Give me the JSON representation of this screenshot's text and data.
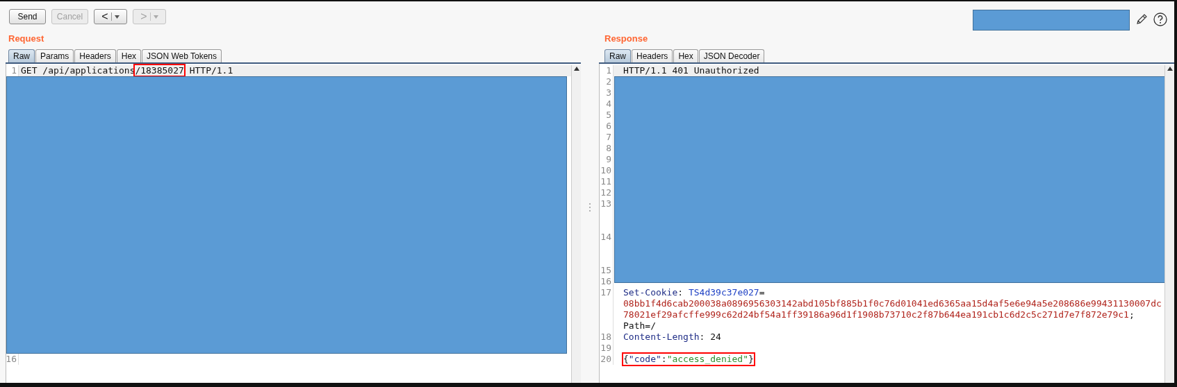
{
  "toolbar": {
    "buttons": [
      {
        "label": "Send",
        "kind": "text",
        "disabled": false
      },
      {
        "label": "Cancel",
        "kind": "text",
        "disabled": true
      },
      {
        "label": "<",
        "kind": "nav",
        "disabled": false
      },
      {
        "label": ">",
        "kind": "nav",
        "disabled": true
      }
    ]
  },
  "request": {
    "title": "Request",
    "tabs": [
      {
        "label": "Raw",
        "selected": true
      },
      {
        "label": "Params",
        "selected": false
      },
      {
        "label": "Headers",
        "selected": false
      },
      {
        "label": "Hex",
        "selected": false
      },
      {
        "label": "JSON Web Tokens",
        "selected": false
      }
    ],
    "lines": [
      {
        "kind": "line",
        "number": "1",
        "current": true,
        "parts": [
          {
            "text": "GET /api/applications",
            "kind": "plain"
          },
          {
            "text": "/18385027",
            "kind": "plain",
            "boxed": true
          },
          {
            "text": " HTTP/1.1",
            "kind": "plain"
          }
        ]
      },
      {
        "kind": "hidden"
      },
      {
        "kind": "line",
        "number": "16"
      }
    ]
  },
  "response": {
    "title": "Response",
    "tabs": [
      {
        "label": "Raw",
        "selected": true
      },
      {
        "label": "Headers",
        "selected": false
      },
      {
        "label": "Hex",
        "selected": false
      },
      {
        "label": "JSON Decoder",
        "selected": false
      }
    ],
    "lines": [
      {
        "kind": "line",
        "number": "1",
        "current": true,
        "parts": [
          {
            "text": "HTTP/1.1 401 Unauthorized",
            "kind": "plain"
          }
        ]
      },
      {
        "kind": "redacted",
        "number": "2"
      },
      {
        "kind": "redacted",
        "number": "3"
      },
      {
        "kind": "redacted",
        "number": "4"
      },
      {
        "kind": "redacted",
        "number": "5"
      },
      {
        "kind": "redacted",
        "number": "6"
      },
      {
        "kind": "redacted",
        "number": "7"
      },
      {
        "kind": "redacted",
        "number": "8"
      },
      {
        "kind": "redacted",
        "number": "9"
      },
      {
        "kind": "redacted",
        "number": "10"
      },
      {
        "kind": "redacted",
        "number": "11"
      },
      {
        "kind": "redacted",
        "number": "12"
      },
      {
        "kind": "redacted",
        "number": "13"
      },
      {
        "kind": "redacted_tall",
        "number": "14"
      },
      {
        "kind": "redacted_tall",
        "number": "15"
      },
      {
        "kind": "redacted",
        "number": "16"
      },
      {
        "kind": "line",
        "number": "17",
        "parts": [
          {
            "text": "Set-Cookie",
            "kind": "header_name"
          },
          {
            "text": ": ",
            "kind": "plain"
          },
          {
            "text": "TS4d39c37e027",
            "kind": "cookie_name"
          },
          {
            "text": "=",
            "kind": "plain"
          },
          {
            "text": "08bb1f4d6cab200038a0896956303142abd105bf885b1f0c76d01041ed6365aa15d4af5e6e94a5e208686e99431130007dc",
            "kind": "cookie_value",
            "new_row": true
          },
          {
            "text": "78021ef29afcffe999c62d24bf54a1ff39186a96d1f1908b73710c2f87b644ea191cb1c6d2c5c271d7e7f872e79c1",
            "kind": "cookie_value",
            "new_row": true
          },
          {
            "text": ";",
            "kind": "plain"
          },
          {
            "text": "Path=/",
            "kind": "plain",
            "new_row": true
          }
        ]
      },
      {
        "kind": "line",
        "number": "18",
        "parts": [
          {
            "text": "Content-Length",
            "kind": "header_name"
          },
          {
            "text": ": 24",
            "kind": "plain"
          }
        ]
      },
      {
        "kind": "line",
        "number": "19"
      },
      {
        "kind": "line",
        "number": "20",
        "boxed": true,
        "parts": [
          {
            "text": "{",
            "kind": "plain"
          },
          {
            "text": "\"code\"",
            "kind": "json_key"
          },
          {
            "text": ":",
            "kind": "plain"
          },
          {
            "text": "\"access_denied\"",
            "kind": "json_string"
          },
          {
            "text": "}",
            "kind": "plain"
          }
        ]
      }
    ]
  }
}
